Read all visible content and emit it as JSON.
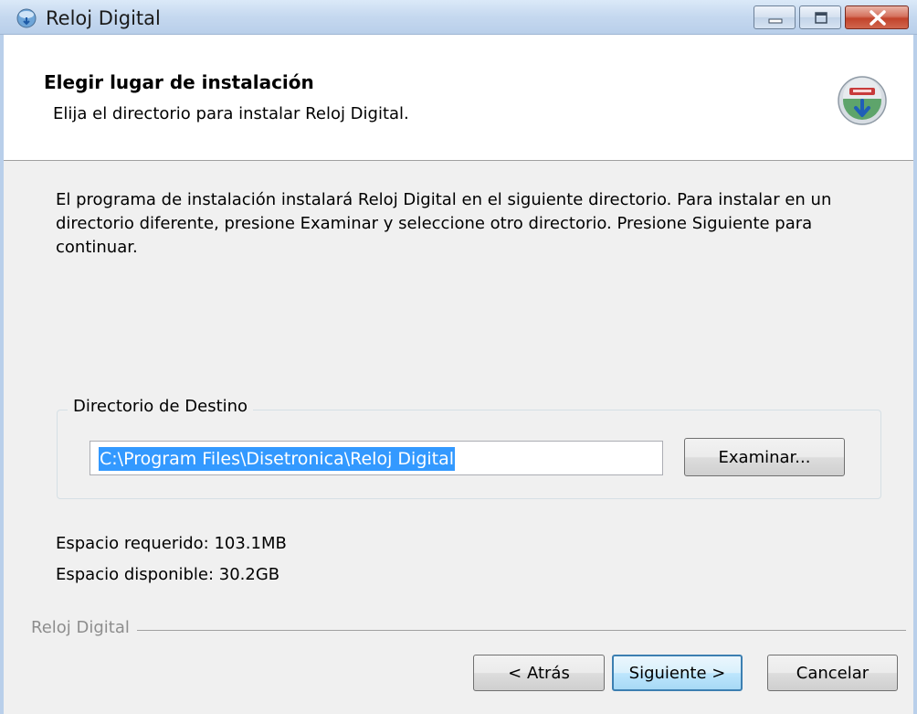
{
  "window": {
    "title": "Reloj Digital"
  },
  "header": {
    "title": "Elegir lugar de instalación",
    "subtitle": "Elija el directorio para instalar Reloj Digital."
  },
  "body": {
    "description": "El programa de instalación instalará Reloj Digital en el siguiente directorio. Para instalar en un directorio diferente, presione Examinar y seleccione otro directorio. Presione Siguiente para continuar.",
    "destination_group_label": "Directorio de Destino",
    "destination_path": "C:\\Program Files\\Disetronica\\Reloj Digital",
    "browse_label": "Examinar...",
    "space_required": "Espacio requerido: 103.1MB",
    "space_available": "Espacio disponible: 30.2GB"
  },
  "footer": {
    "brand": "Reloj Digital",
    "back_label": "< Atrás",
    "next_label": "Siguiente >",
    "cancel_label": "Cancelar"
  },
  "colors": {
    "selection": "#3399ff",
    "titlebar": "#c5d8ef",
    "close_button": "#c2432b",
    "dialog_bg": "#f0f0f0"
  },
  "icons": {
    "app": "installer-globe-icon",
    "header": "install-disk-icon",
    "minimize": "minimize-icon",
    "maximize": "maximize-icon",
    "close": "close-icon"
  }
}
